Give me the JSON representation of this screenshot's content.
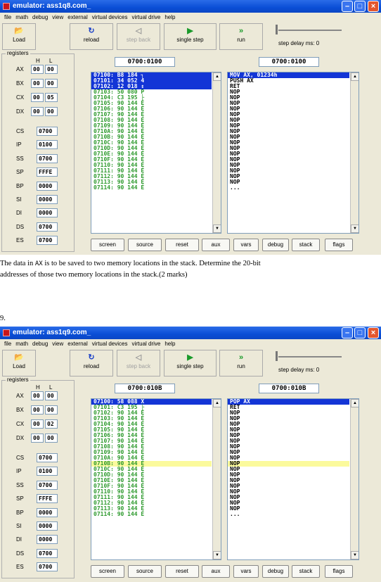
{
  "windows": [
    {
      "title": "emulator: ass1q8.com_",
      "menu": [
        "file",
        "math",
        "debug",
        "view",
        "external",
        "virtual devices",
        "virtual drive",
        "help"
      ],
      "toolbar": {
        "load": "Load",
        "reload": "reload",
        "step_back": "step back",
        "single_step": "single step",
        "run": "run",
        "step_delay": "step delay ms: 0"
      },
      "registers_label": "registers",
      "reg_high": "H",
      "reg_low": "L",
      "regs8": [
        {
          "name": "AX",
          "h": "00",
          "l": "00"
        },
        {
          "name": "BX",
          "h": "00",
          "l": "00"
        },
        {
          "name": "CX",
          "h": "00",
          "l": "05"
        },
        {
          "name": "DX",
          "h": "00",
          "l": "00"
        }
      ],
      "regs16": [
        {
          "name": "CS",
          "v": "0700"
        },
        {
          "name": "IP",
          "v": "0100"
        },
        {
          "name": "SS",
          "v": "0700"
        },
        {
          "name": "SP",
          "v": "FFFE"
        },
        {
          "name": "BP",
          "v": "0000"
        },
        {
          "name": "SI",
          "v": "0000"
        },
        {
          "name": "DI",
          "v": "0000"
        },
        {
          "name": "DS",
          "v": "0700"
        },
        {
          "name": "ES",
          "v": "0700"
        }
      ],
      "addr_left": "0700:0100",
      "addr_right": "0700:0100",
      "memory": [
        "07100: B8 184 ┐",
        "07101: 34 052 4",
        "07102: 12 018 ↕",
        "07103: 50 080 P",
        "07104: C3 195 ├",
        "07105: 90 144 É",
        "07106: 90 144 É",
        "07107: 90 144 É",
        "07108: 90 144 É",
        "07109: 90 144 É",
        "0710A: 90 144 É",
        "0710B: 90 144 É",
        "0710C: 90 144 É",
        "0710D: 90 144 É",
        "0710E: 90 144 É",
        "0710F: 90 144 É",
        "07110: 90 144 É",
        "07111: 90 144 É",
        "07112: 90 144 É",
        "07113: 90 144 É",
        "07114: 90 144 É"
      ],
      "disasm": [
        "MOV AX, 01234h",
        "PUSH AX",
        "RET",
        "NOP",
        "NOP",
        "NOP",
        "NOP",
        "NOP",
        "NOP",
        "NOP",
        "NOP",
        "NOP",
        "NOP",
        "NOP",
        "NOP",
        "NOP",
        "NOP",
        "NOP",
        "NOP",
        "NOP",
        "..."
      ],
      "buttons": [
        "screen",
        "source",
        "reset",
        "aux",
        "vars",
        "debug",
        "stack",
        "flags"
      ]
    },
    {
      "title": "emulator: ass1q9.com_",
      "menu": [
        "file",
        "math",
        "debug",
        "view",
        "external",
        "virtual devices",
        "virtual drive",
        "help"
      ],
      "toolbar": {
        "load": "Load",
        "reload": "reload",
        "step_back": "step back",
        "single_step": "single step",
        "run": "run",
        "step_delay": "step delay ms: 0"
      },
      "registers_label": "registers",
      "reg_high": "H",
      "reg_low": "L",
      "regs8": [
        {
          "name": "AX",
          "h": "00",
          "l": "00"
        },
        {
          "name": "BX",
          "h": "00",
          "l": "00"
        },
        {
          "name": "CX",
          "h": "00",
          "l": "02"
        },
        {
          "name": "DX",
          "h": "00",
          "l": "00"
        }
      ],
      "regs16": [
        {
          "name": "CS",
          "v": "0700"
        },
        {
          "name": "IP",
          "v": "0100"
        },
        {
          "name": "SS",
          "v": "0700"
        },
        {
          "name": "SP",
          "v": "FFFE"
        },
        {
          "name": "BP",
          "v": "0000"
        },
        {
          "name": "SI",
          "v": "0000"
        },
        {
          "name": "DI",
          "v": "0000"
        },
        {
          "name": "DS",
          "v": "0700"
        },
        {
          "name": "ES",
          "v": "0700"
        }
      ],
      "addr_left": "0700:010B",
      "addr_right": "0700:010B",
      "memory": [
        "07100: 58 088 X",
        "07101: C3 195 ├",
        "07102: 90 144 É",
        "07103: 90 144 É",
        "07104: 90 144 É",
        "07105: 90 144 É",
        "07106: 90 144 É",
        "07107: 90 144 É",
        "07108: 90 144 É",
        "07109: 90 144 É",
        "0710A: 90 144 É",
        "0710B: 90 144 É",
        "0710C: 90 144 É",
        "0710D: 90 144 É",
        "0710E: 90 144 É",
        "0710F: 90 144 É",
        "07110: 90 144 É",
        "07111: 90 144 É",
        "07112: 90 144 É",
        "07113: 90 144 É",
        "07114: 90 144 É"
      ],
      "disasm": [
        "POP AX",
        "RET",
        "NOP",
        "NOP",
        "NOP",
        "NOP",
        "NOP",
        "NOP",
        "NOP",
        "NOP",
        "NOP",
        "NOP",
        "NOP",
        "NOP",
        "NOP",
        "NOP",
        "NOP",
        "NOP",
        "NOP",
        "NOP",
        "..."
      ],
      "buttons": [
        "screen",
        "source",
        "reset",
        "aux",
        "vars",
        "debug",
        "stack",
        "flags"
      ]
    }
  ],
  "question": {
    "line1_a": "The data in",
    "line1_reg": "AX",
    "line1_b": "is to be saved to two memory locations in the stack. Determine the 20-bit",
    "line2": "addresses of those two memory locations in the stack.(2 marks)",
    "number": "9."
  },
  "colors": {
    "selection": "#1335d6",
    "highlight": "#fbfa9c",
    "code_green": "#2e9a2e",
    "titlebar": "#0a4ed6"
  },
  "icons": {
    "load": "folder-open-icon",
    "reload": "reload-icon",
    "step_back": "step-back-icon",
    "single_step": "single-step-icon",
    "run": "run-icon"
  }
}
